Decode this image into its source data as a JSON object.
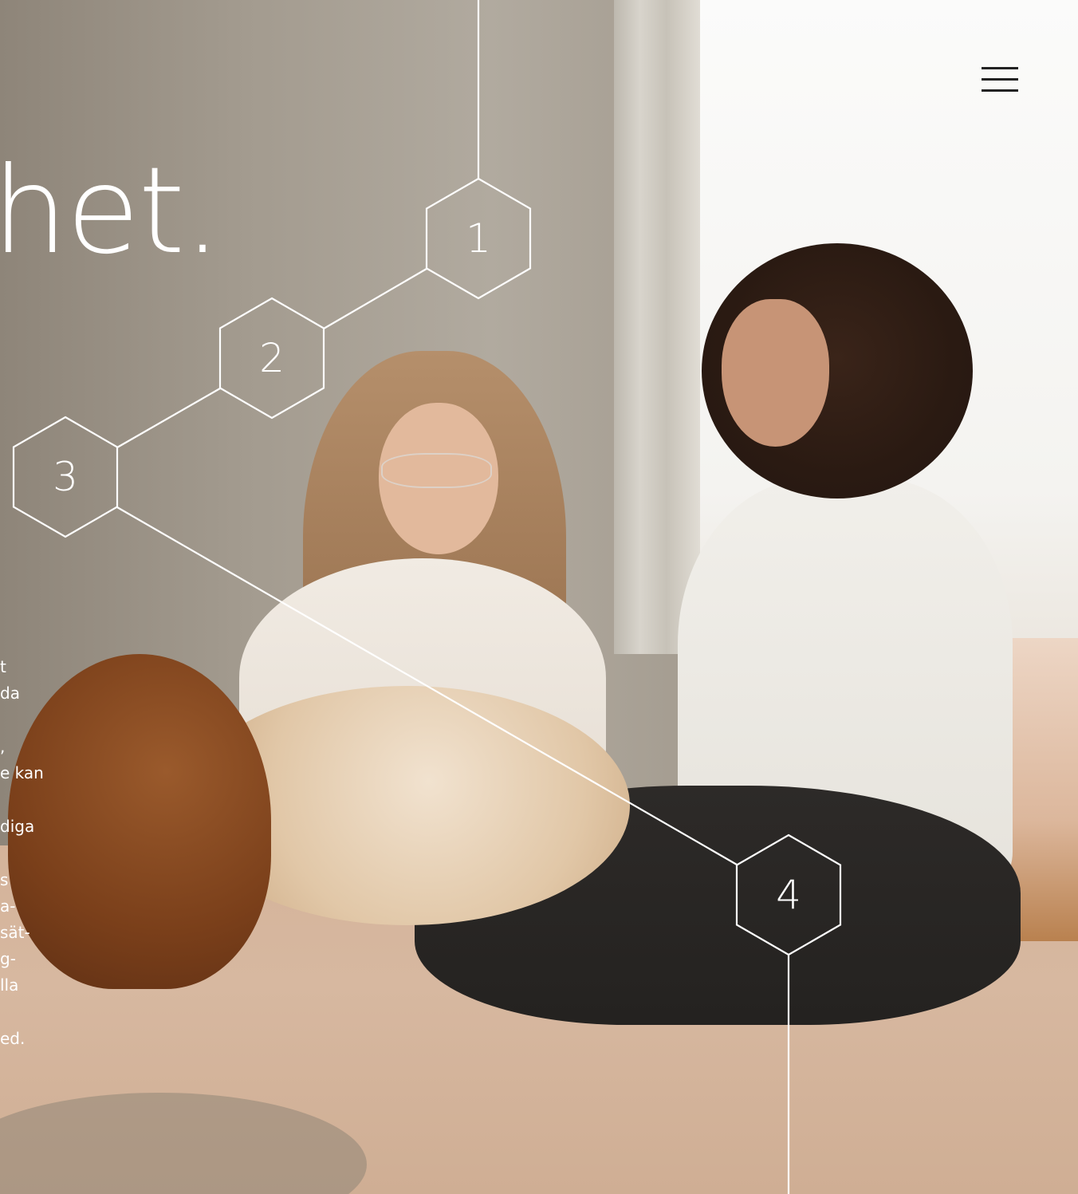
{
  "hero": {
    "headline": "het."
  },
  "body_copy": {
    "fragments": [
      "t",
      "da",
      ",",
      "e kan",
      "diga",
      "s",
      "a-",
      "sät-",
      "g-",
      "lla",
      "ed."
    ]
  },
  "menu": {
    "icon": "hamburger-menu-icon",
    "bar_color": "#222222"
  },
  "steps": [
    "1",
    "2",
    "3",
    "4"
  ],
  "colors": {
    "line": "#ffffff",
    "text": "#ffffff"
  }
}
